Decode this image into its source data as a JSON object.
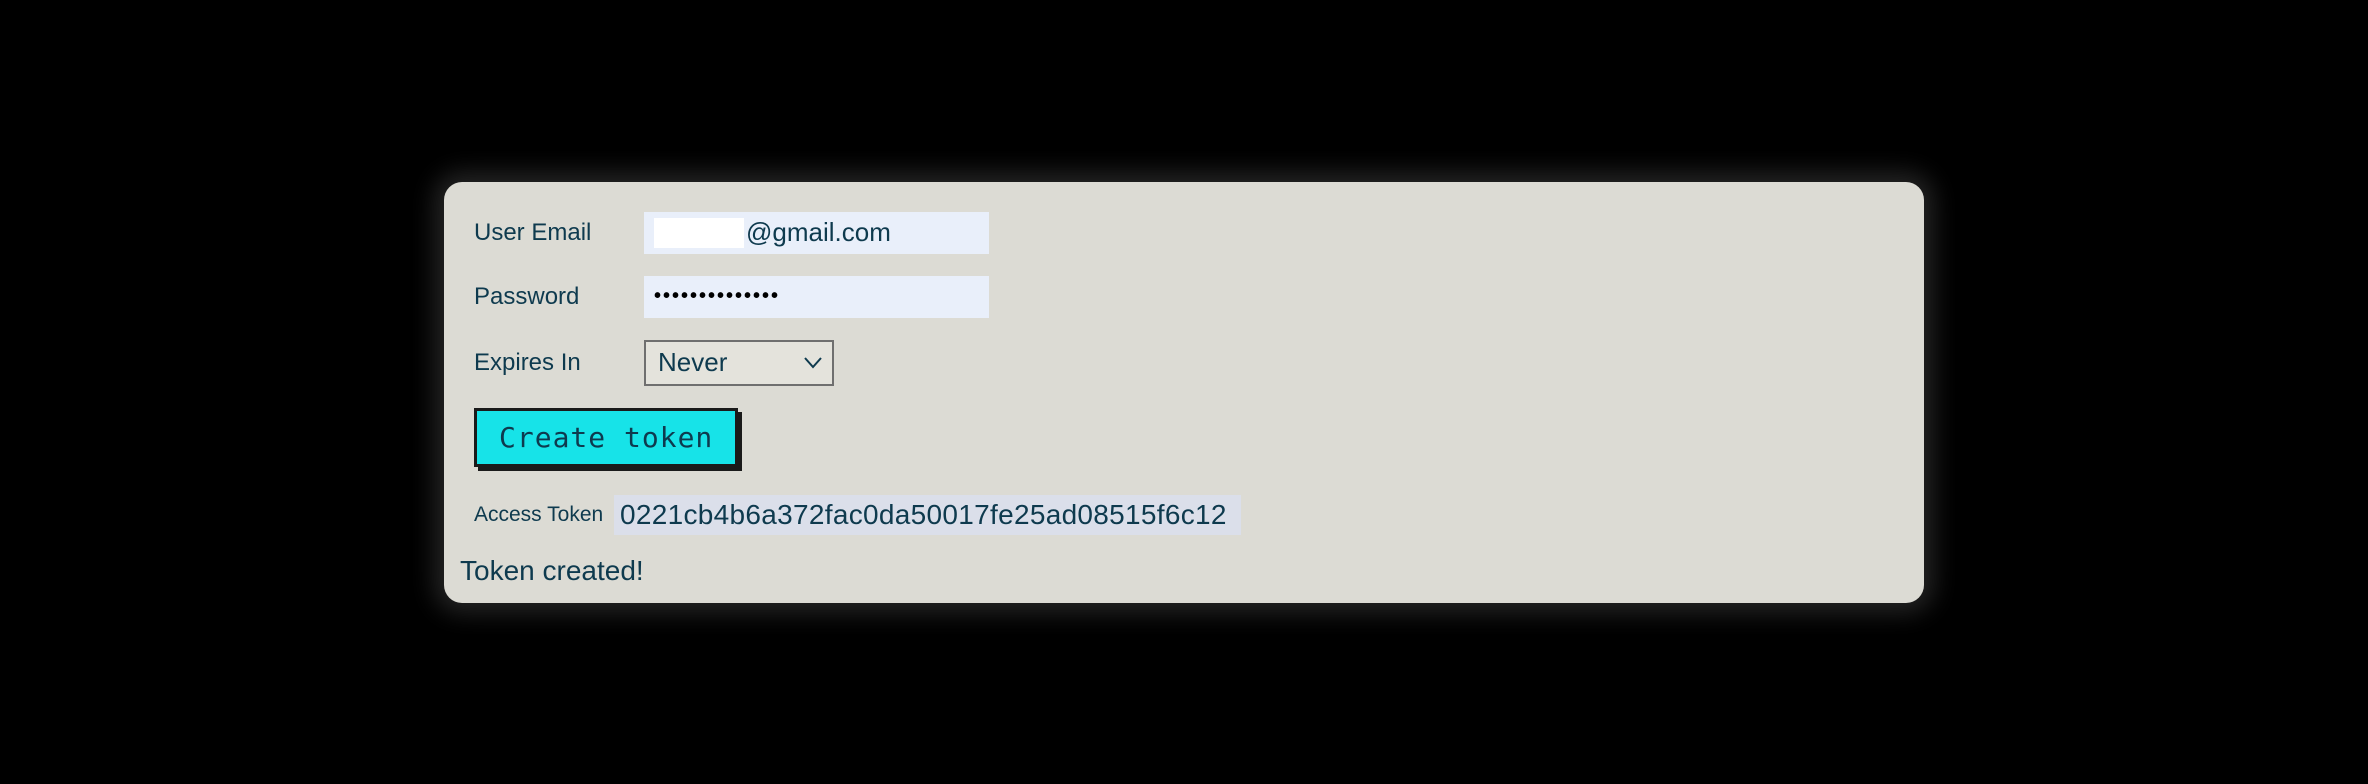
{
  "form": {
    "email_label": "User Email",
    "email_domain": "@gmail.com",
    "password_label": "Password",
    "password_masked": "••••••••••••••",
    "expires_label": "Expires In",
    "expires_value": "Never",
    "create_button": "Create token",
    "access_token_label": "Access Token",
    "access_token_value": "0221cb4b6a372fac0da50017fe25ad08515f6c12",
    "status_message": "Token created!"
  }
}
